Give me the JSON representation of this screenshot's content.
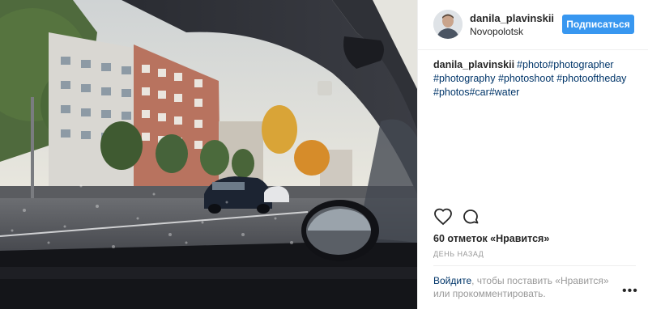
{
  "post": {
    "username": "danila_plavinskii",
    "location": "Novopolotsk",
    "follow_label": "Подписаться"
  },
  "caption": {
    "author": "danila_plavinskii",
    "hashtags": [
      "#photo",
      "#photographer",
      "#photography",
      "#photoshoot",
      "#photooftheday",
      "#photos",
      "#car",
      "#water"
    ]
  },
  "actions": {
    "like_icon": "heart-icon",
    "comment_icon": "speech-bubble-icon"
  },
  "likes_text": "60 отметок «Нравится»",
  "time_text": "ДЕНЬ НАЗАД",
  "login_prompt": {
    "link": "Войдите",
    "text": ", чтобы поставить «Нравится» или прокомментировать."
  },
  "more_label": "•••",
  "colors": {
    "accent": "#3897f0",
    "hashtag": "#003569",
    "muted": "#999999",
    "text": "#262626"
  }
}
